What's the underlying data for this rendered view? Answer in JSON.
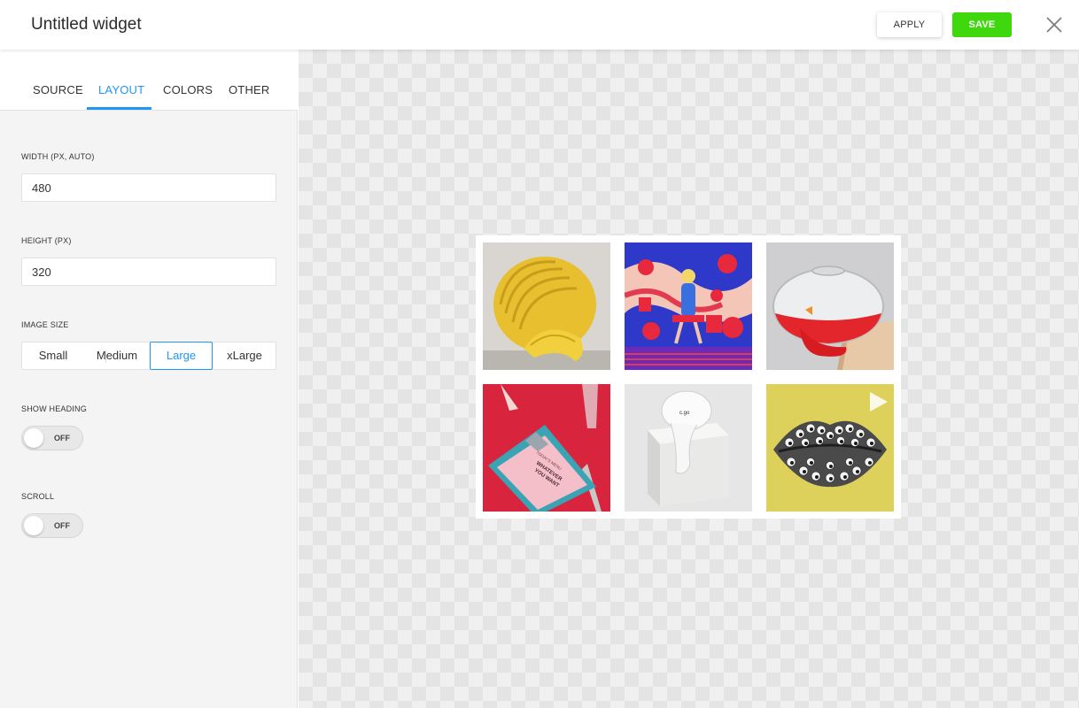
{
  "header": {
    "title": "Untitled widget",
    "apply_label": "APPLY",
    "save_label": "SAVE"
  },
  "tabs": [
    {
      "label": "SOURCE",
      "active": false
    },
    {
      "label": "LAYOUT",
      "active": true
    },
    {
      "label": "COLORS",
      "active": false
    },
    {
      "label": "OTHER",
      "active": false
    }
  ],
  "layout": {
    "width_label": "WIDTH (PX, AUTO)",
    "width_value": "480",
    "height_label": "HEIGHT (PX)",
    "height_value": "320",
    "image_size_label": "IMAGE SIZE",
    "image_sizes": [
      "Small",
      "Medium",
      "Large",
      "xLarge"
    ],
    "image_size_selected": "Large",
    "show_heading_label": "SHOW HEADING",
    "show_heading_state": "OFF",
    "scroll_label": "SCROLL",
    "scroll_state": "OFF"
  },
  "preview": {
    "images": [
      {
        "name": "yellow-sculpture"
      },
      {
        "name": "red-blue-room"
      },
      {
        "name": "goldfish-bowl"
      },
      {
        "name": "pink-menu-clipboard",
        "text": [
          "TODAY'S MENU",
          "WHATEVER",
          "YOU WANT"
        ]
      },
      {
        "name": "white-balloon-box",
        "text": "c.go"
      },
      {
        "name": "googly-eye-lips",
        "has_play_icon": true
      }
    ]
  },
  "colors": {
    "accent": "#2196f3",
    "save": "#3fd80e"
  }
}
